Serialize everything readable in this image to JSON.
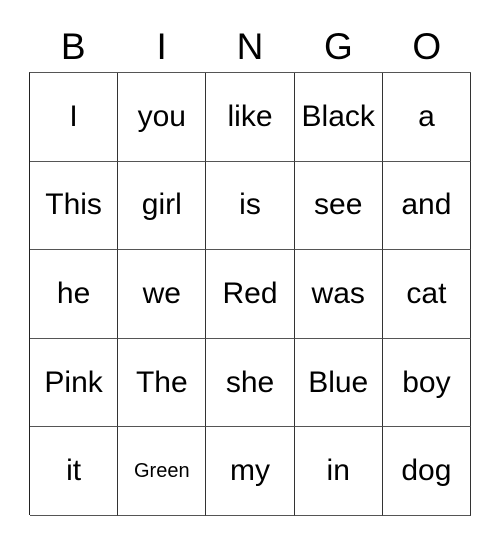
{
  "card": {
    "title": "BINGO",
    "header_letters": [
      "B",
      "I",
      "N",
      "G",
      "O"
    ],
    "rows": [
      [
        {
          "text": "I",
          "size": "normal"
        },
        {
          "text": "you",
          "size": "normal"
        },
        {
          "text": "like",
          "size": "normal"
        },
        {
          "text": "Black",
          "size": "normal"
        },
        {
          "text": "a",
          "size": "normal"
        }
      ],
      [
        {
          "text": "This",
          "size": "normal"
        },
        {
          "text": "girl",
          "size": "normal"
        },
        {
          "text": "is",
          "size": "normal"
        },
        {
          "text": "see",
          "size": "normal"
        },
        {
          "text": "and",
          "size": "normal"
        }
      ],
      [
        {
          "text": "he",
          "size": "normal"
        },
        {
          "text": "we",
          "size": "normal"
        },
        {
          "text": "Red",
          "size": "normal"
        },
        {
          "text": "was",
          "size": "normal"
        },
        {
          "text": "cat",
          "size": "normal"
        }
      ],
      [
        {
          "text": "Pink",
          "size": "normal"
        },
        {
          "text": "The",
          "size": "normal"
        },
        {
          "text": "she",
          "size": "normal"
        },
        {
          "text": "Blue",
          "size": "normal"
        },
        {
          "text": "boy",
          "size": "normal"
        }
      ],
      [
        {
          "text": "it",
          "size": "normal"
        },
        {
          "text": "Green",
          "size": "small"
        },
        {
          "text": "my",
          "size": "normal"
        },
        {
          "text": "in",
          "size": "normal"
        },
        {
          "text": "dog",
          "size": "normal"
        }
      ]
    ],
    "colors": {
      "background": "#ffffff",
      "text": "#000000",
      "border": "#333333"
    }
  }
}
